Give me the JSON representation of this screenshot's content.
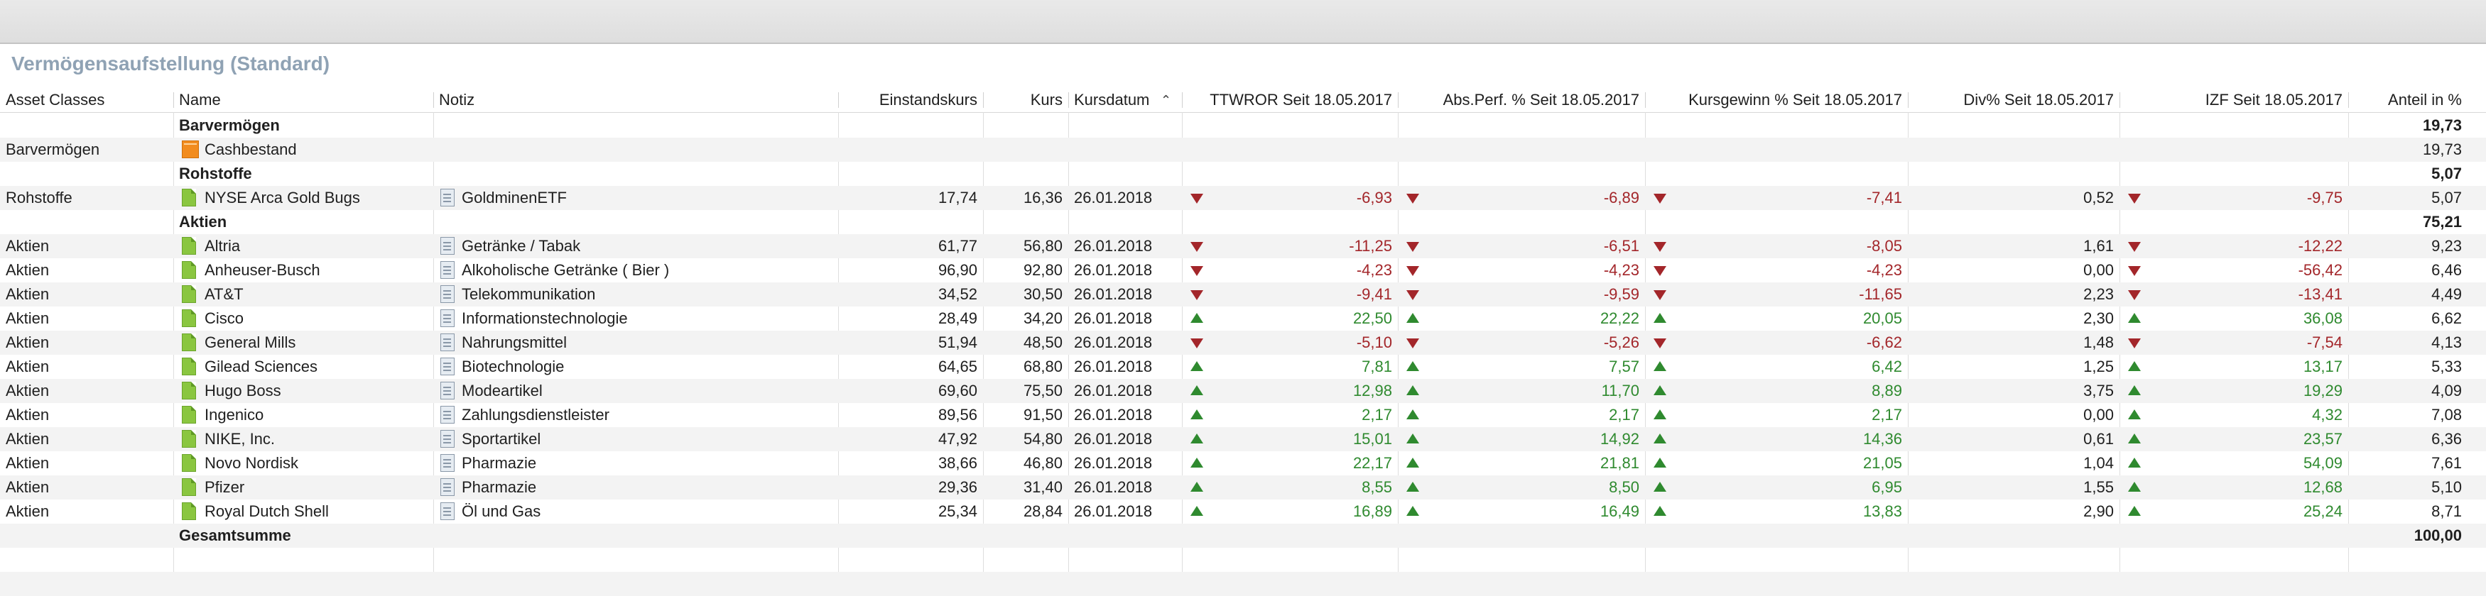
{
  "title": "Vermögensaufstellung (Standard)",
  "columns": {
    "asset_classes": "Asset Classes",
    "name": "Name",
    "notiz": "Notiz",
    "einstandskurs": "Einstandskurs",
    "kurs": "Kurs",
    "kursdatum": "Kursdatum",
    "ttwror": "TTWROR Seit 18.05.2017",
    "absperf": "Abs.Perf. % Seit 18.05.2017",
    "kursgewinn": "Kursgewinn % Seit 18.05.2017",
    "div": "Div% Seit 18.05.2017",
    "izf": "IZF Seit 18.05.2017",
    "anteil": "Anteil in %"
  },
  "sort_icon": "chevron-up-icon",
  "colors": {
    "title": "#8fa2b4",
    "negative": "#a3262a",
    "positive": "#2f8a2f"
  },
  "rows": [
    {
      "type": "group",
      "name": "Barvermögen",
      "anteil": "19,73"
    },
    {
      "type": "cash",
      "asset_class": "Barvermögen",
      "name": "Cashbestand",
      "anteil": "19,73"
    },
    {
      "type": "group",
      "name": "Rohstoffe",
      "anteil": "5,07"
    },
    {
      "type": "security",
      "asset_class": "Rohstoffe",
      "name": "NYSE Arca Gold Bugs",
      "notiz": "GoldminenETF",
      "einstandskurs": "17,74",
      "kurs": "16,36",
      "kursdatum": "26.01.2018",
      "ttwror": "-6,93",
      "absperf": "-6,89",
      "kursgewinn": "-7,41",
      "div": "0,52",
      "izf": "-9,75",
      "anteil": "5,07"
    },
    {
      "type": "group",
      "name": "Aktien",
      "anteil": "75,21"
    },
    {
      "type": "security",
      "asset_class": "Aktien",
      "name": "Altria",
      "notiz": "Getränke / Tabak",
      "einstandskurs": "61,77",
      "kurs": "56,80",
      "kursdatum": "26.01.2018",
      "ttwror": "-11,25",
      "absperf": "-6,51",
      "kursgewinn": "-8,05",
      "div": "1,61",
      "izf": "-12,22",
      "anteil": "9,23"
    },
    {
      "type": "security",
      "asset_class": "Aktien",
      "name": "Anheuser-Busch",
      "notiz": "Alkoholische Getränke ( Bier )",
      "einstandskurs": "96,90",
      "kurs": "92,80",
      "kursdatum": "26.01.2018",
      "ttwror": "-4,23",
      "absperf": "-4,23",
      "kursgewinn": "-4,23",
      "div": "0,00",
      "izf": "-56,42",
      "anteil": "6,46"
    },
    {
      "type": "security",
      "asset_class": "Aktien",
      "name": "AT&T",
      "notiz": "Telekommunikation",
      "einstandskurs": "34,52",
      "kurs": "30,50",
      "kursdatum": "26.01.2018",
      "ttwror": "-9,41",
      "absperf": "-9,59",
      "kursgewinn": "-11,65",
      "div": "2,23",
      "izf": "-13,41",
      "anteil": "4,49"
    },
    {
      "type": "security",
      "asset_class": "Aktien",
      "name": "Cisco",
      "notiz": "Informationstechnologie",
      "einstandskurs": "28,49",
      "kurs": "34,20",
      "kursdatum": "26.01.2018",
      "ttwror": "22,50",
      "absperf": "22,22",
      "kursgewinn": "20,05",
      "div": "2,30",
      "izf": "36,08",
      "anteil": "6,62"
    },
    {
      "type": "security",
      "asset_class": "Aktien",
      "name": "General Mills",
      "notiz": "Nahrungsmittel",
      "einstandskurs": "51,94",
      "kurs": "48,50",
      "kursdatum": "26.01.2018",
      "ttwror": "-5,10",
      "absperf": "-5,26",
      "kursgewinn": "-6,62",
      "div": "1,48",
      "izf": "-7,54",
      "anteil": "4,13"
    },
    {
      "type": "security",
      "asset_class": "Aktien",
      "name": "Gilead Sciences",
      "notiz": "Biotechnologie",
      "einstandskurs": "64,65",
      "kurs": "68,80",
      "kursdatum": "26.01.2018",
      "ttwror": "7,81",
      "absperf": "7,57",
      "kursgewinn": "6,42",
      "div": "1,25",
      "izf": "13,17",
      "anteil": "5,33"
    },
    {
      "type": "security",
      "asset_class": "Aktien",
      "name": "Hugo Boss",
      "notiz": "Modeartikel",
      "einstandskurs": "69,60",
      "kurs": "75,50",
      "kursdatum": "26.01.2018",
      "ttwror": "12,98",
      "absperf": "11,70",
      "kursgewinn": "8,89",
      "div": "3,75",
      "izf": "19,29",
      "anteil": "4,09"
    },
    {
      "type": "security",
      "asset_class": "Aktien",
      "name": "Ingenico",
      "notiz": "Zahlungsdienstleister",
      "einstandskurs": "89,56",
      "kurs": "91,50",
      "kursdatum": "26.01.2018",
      "ttwror": "2,17",
      "absperf": "2,17",
      "kursgewinn": "2,17",
      "div": "0,00",
      "izf": "4,32",
      "anteil": "7,08"
    },
    {
      "type": "security",
      "asset_class": "Aktien",
      "name": "NIKE, Inc.",
      "notiz": "Sportartikel",
      "einstandskurs": "47,92",
      "kurs": "54,80",
      "kursdatum": "26.01.2018",
      "ttwror": "15,01",
      "absperf": "14,92",
      "kursgewinn": "14,36",
      "div": "0,61",
      "izf": "23,57",
      "anteil": "6,36"
    },
    {
      "type": "security",
      "asset_class": "Aktien",
      "name": "Novo Nordisk",
      "notiz": "Pharmazie",
      "einstandskurs": "38,66",
      "kurs": "46,80",
      "kursdatum": "26.01.2018",
      "ttwror": "22,17",
      "absperf": "21,81",
      "kursgewinn": "21,05",
      "div": "1,04",
      "izf": "54,09",
      "anteil": "7,61"
    },
    {
      "type": "security",
      "asset_class": "Aktien",
      "name": "Pfizer",
      "notiz": "Pharmazie",
      "einstandskurs": "29,36",
      "kurs": "31,40",
      "kursdatum": "26.01.2018",
      "ttwror": "8,55",
      "absperf": "8,50",
      "kursgewinn": "6,95",
      "div": "1,55",
      "izf": "12,68",
      "anteil": "5,10"
    },
    {
      "type": "security",
      "asset_class": "Aktien",
      "name": "Royal Dutch Shell",
      "notiz": "Öl und Gas",
      "einstandskurs": "25,34",
      "kurs": "28,84",
      "kursdatum": "26.01.2018",
      "ttwror": "16,89",
      "absperf": "16,49",
      "kursgewinn": "13,83",
      "div": "2,90",
      "izf": "25,24",
      "anteil": "8,71"
    },
    {
      "type": "total",
      "name": "Gesamtsumme",
      "anteil": "100,00"
    }
  ]
}
